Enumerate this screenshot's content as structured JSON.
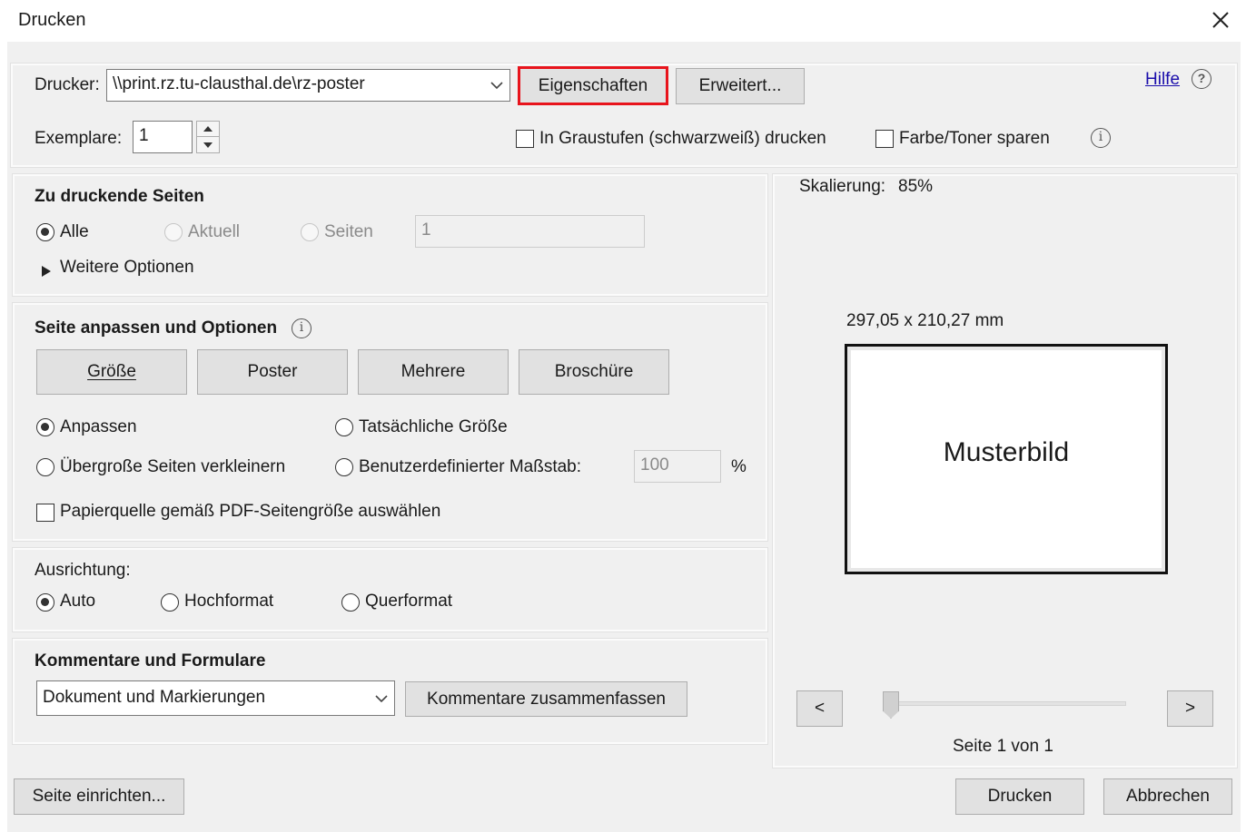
{
  "window": {
    "title": "Drucken"
  },
  "printer": {
    "label": "Drucker:",
    "value": "\\\\print.rz.tu-clausthal.de\\rz-poster",
    "properties_button": "Eigenschaften",
    "advanced_button": "Erweitert...",
    "help_link": "Hilfe",
    "highlight_color": "#e8141c"
  },
  "copies": {
    "label": "Exemplare:",
    "value": "1",
    "grayscale_label": "In Graustufen (schwarzweiß) drucken",
    "save_ink_label": "Farbe/Toner sparen"
  },
  "pages_section": {
    "title": "Zu druckende Seiten",
    "all_label": "Alle",
    "current_label": "Aktuell",
    "pages_label": "Seiten",
    "pages_value": "1",
    "more_options_label": "Weitere Optionen",
    "selected": "Alle"
  },
  "sizing_section": {
    "title": "Seite anpassen und Optionen",
    "tabs": [
      "Größe",
      "Poster",
      "Mehrere",
      "Broschüre"
    ],
    "fit_label": "Anpassen",
    "actual_size_label": "Tatsächliche Größe",
    "shrink_label": "Übergroße Seiten verkleinern",
    "custom_scale_label": "Benutzerdefinierter Maßstab:",
    "custom_scale_value": "100",
    "percent_sign": "%",
    "paper_source_label": "Papierquelle gemäß PDF-Seitengröße auswählen",
    "selected": "Anpassen"
  },
  "orientation_section": {
    "title": "Ausrichtung:",
    "auto_label": "Auto",
    "portrait_label": "Hochformat",
    "landscape_label": "Querformat",
    "selected": "Auto"
  },
  "comments_section": {
    "title": "Kommentare und Formulare",
    "select_value": "Dokument und Markierungen",
    "summarize_button": "Kommentare zusammenfassen"
  },
  "preview": {
    "scaling_label": "Skalierung:",
    "scaling_value": "85%",
    "dimensions": "297,05 x 210,27 mm",
    "sample_text": "Musterbild",
    "prev_button": "<",
    "next_button": ">",
    "page_indicator": "Seite 1 von 1",
    "slider_position": 0
  },
  "footer": {
    "page_setup_button": "Seite einrichten...",
    "print_button": "Drucken",
    "cancel_button": "Abbrechen"
  }
}
